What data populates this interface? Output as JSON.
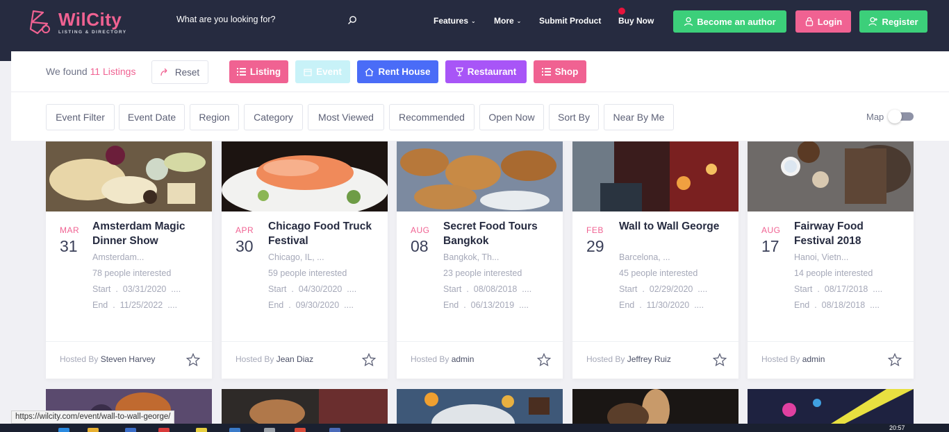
{
  "header": {
    "logo_title": "WilCity",
    "logo_subtitle": "LISTING & DIRECTORY",
    "search_placeholder": "What are you looking for?",
    "nav": [
      {
        "label": "Features"
      },
      {
        "label": "More"
      },
      {
        "label": "Submit Product"
      },
      {
        "label": "Buy Now"
      }
    ],
    "become_author": "Become an author",
    "login": "Login",
    "register": "Register"
  },
  "results": {
    "found_prefix": "We found",
    "found_count": "11 Listings",
    "reset": "Reset"
  },
  "types": [
    {
      "label": "Listing",
      "color": "#f06292"
    },
    {
      "label": "Event",
      "color": "#c8f2f8"
    },
    {
      "label": "Rent House",
      "color": "#4a6cf7"
    },
    {
      "label": "Restaurant",
      "color": "#a855f7"
    },
    {
      "label": "Shop",
      "color": "#f06292"
    }
  ],
  "filters": [
    "Event Filter",
    "Event Date",
    "Region",
    "Category",
    "Most Viewed",
    "Recommended",
    "Open Now",
    "Sort By",
    "Near By Me"
  ],
  "map_label": "Map",
  "hosted_by_label": "Hosted By",
  "start_label": "Start",
  "end_label": "End",
  "cards": [
    {
      "month": "MAR",
      "day": "31",
      "title": "Amsterdam Magic Dinner Show",
      "location": "Amsterdam...",
      "interested": "78 people interested",
      "start": "03/31/2020",
      "end": "11/25/2022",
      "host": "Steven Harvey"
    },
    {
      "month": "APR",
      "day": "30",
      "title": "Chicago Food Truck Festival",
      "location": "Chicago, IL, ...",
      "interested": "59 people interested",
      "start": "04/30/2020",
      "end": "09/30/2020",
      "host": "Jean Diaz"
    },
    {
      "month": "AUG",
      "day": "08",
      "title": "Secret Food Tours Bangkok",
      "location": "Bangkok, Th...",
      "interested": "23 people interested",
      "start": "08/08/2018",
      "end": "06/13/2019",
      "host": "admin"
    },
    {
      "month": "FEB",
      "day": "29",
      "title": "Wall to Wall George",
      "location": "Barcelona, ...",
      "interested": "45 people interested",
      "start": "02/29/2020",
      "end": "11/30/2020",
      "host": "Jeffrey Ruiz"
    },
    {
      "month": "AUG",
      "day": "17",
      "title": "Fairway Food Festival 2018",
      "location": "Hanoi, Vietn...",
      "interested": "14 people interested",
      "start": "08/17/2018",
      "end": "08/18/2018",
      "host": "admin"
    }
  ],
  "status_url": "https://wilcity.com/event/wall-to-wall-george/",
  "clock": "20:57",
  "colors": {
    "navbar": "#262b40",
    "accent_pink": "#f06292",
    "green": "#3ccf7a"
  }
}
